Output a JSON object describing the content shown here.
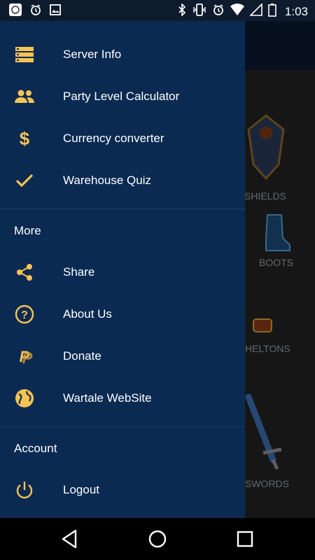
{
  "status_bar": {
    "time": "1:03",
    "left_icons": [
      "app-icon",
      "alarm-icon",
      "image-icon"
    ],
    "right_icons": [
      "bluetooth-icon",
      "vibrate-icon",
      "alarm-icon",
      "wifi-icon",
      "signal-icon",
      "battery-icon"
    ]
  },
  "background": {
    "categories": [
      "SHIELDS",
      "BOOTS",
      "HELTONS",
      "SWORDS"
    ]
  },
  "drawer": {
    "items": [
      {
        "label": "Server Info",
        "icon": "server-icon"
      },
      {
        "label": "Party Level Calculator",
        "icon": "people-icon"
      },
      {
        "label": "Currency converter",
        "icon": "dollar-icon"
      },
      {
        "label": "Warehouse Quiz",
        "icon": "check-icon"
      }
    ],
    "more": {
      "title": "More",
      "items": [
        {
          "label": "Share",
          "icon": "share-icon"
        },
        {
          "label": "About Us",
          "icon": "help-icon"
        },
        {
          "label": "Donate",
          "icon": "paypal-icon"
        },
        {
          "label": "Wartale WebSite",
          "icon": "globe-icon"
        }
      ]
    },
    "account": {
      "title": "Account",
      "items": [
        {
          "label": "Logout",
          "icon": "power-icon"
        }
      ]
    }
  },
  "colors": {
    "drawer_bg": "#0b2a52",
    "icon_accent": "#f6c453",
    "status_bar_bg": "#0d1b2d"
  }
}
